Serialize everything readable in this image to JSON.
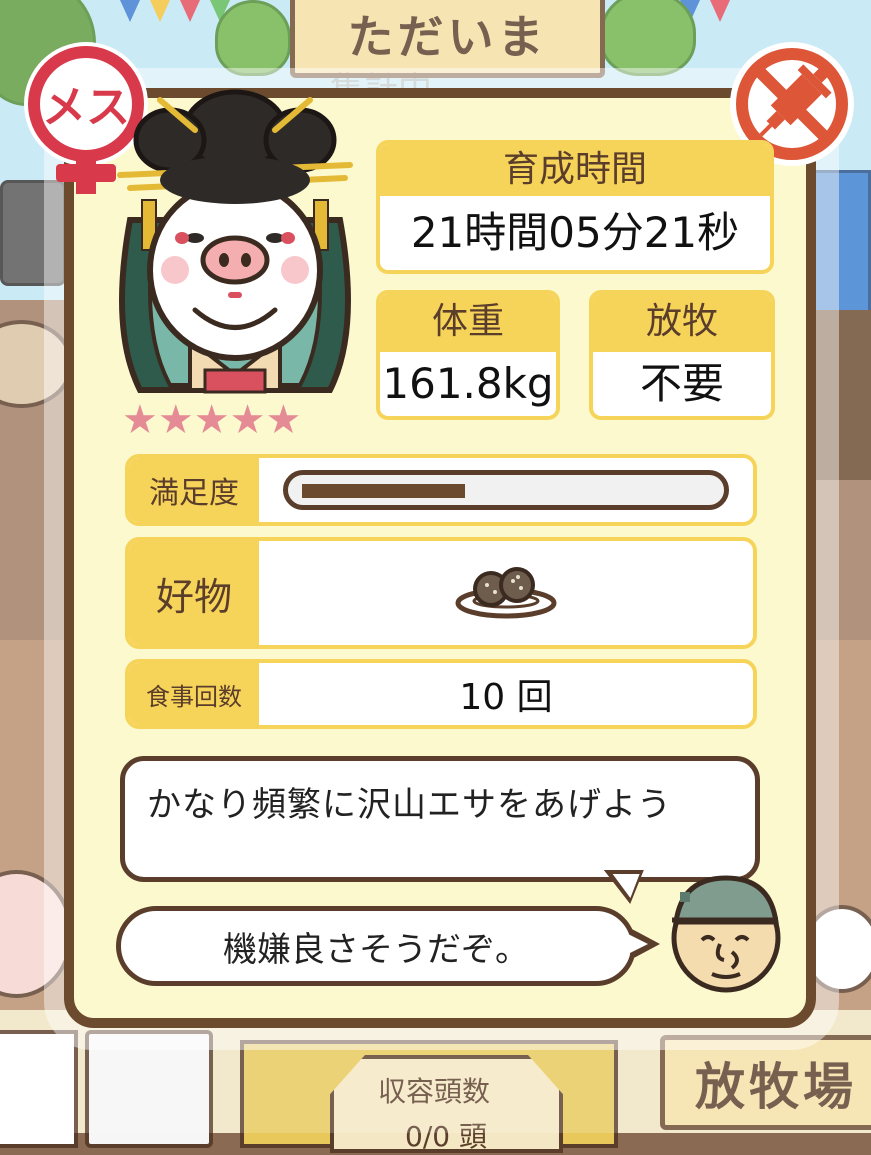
{
  "background": {
    "top_sign": "ただいま",
    "top_sign_sub": "集計中",
    "capacity_label": "収容頭数",
    "capacity_value": "0/0 頭",
    "ranch_sign": "放牧場"
  },
  "badges": {
    "gender_label": "メス",
    "gender_icon": "female-symbol-icon",
    "medicine_icon": "no-medicine-syringe-icon"
  },
  "pig": {
    "rarity_stars": 5,
    "stars_text": "★★★★★"
  },
  "stats": {
    "growth_time_label": "育成時間",
    "growth_time_value": "21時間05分21秒",
    "weight_label": "体重",
    "weight_value": "161.8kg",
    "pasture_label": "放牧",
    "pasture_value": "不要"
  },
  "satisfaction": {
    "label": "満足度",
    "level": 0.4
  },
  "favorite": {
    "label": "好物",
    "icon": "food-plate-icon"
  },
  "meals": {
    "label": "食事回数",
    "value": "10 回"
  },
  "advice": {
    "main": "かなり頻繁に沢山エサをあげよう",
    "mood": "機嫌良さそうだぞ。"
  },
  "colors": {
    "frame": "#6b4a2e",
    "panel": "#fdf9cf",
    "label_bg": "#f6d45a",
    "star": "#e58b95",
    "badge_red": "#d83a4b"
  }
}
